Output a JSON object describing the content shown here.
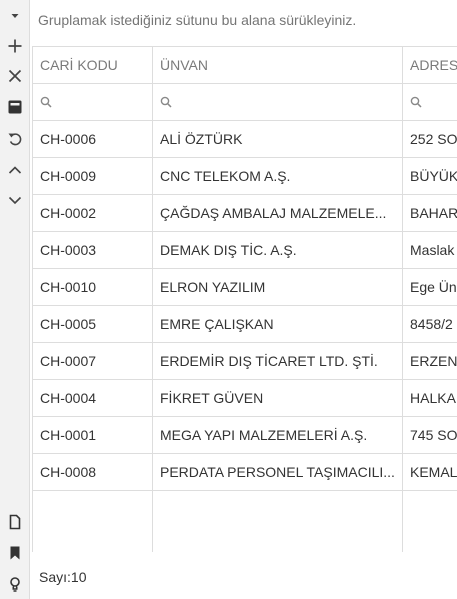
{
  "group_panel": {
    "text": "Gruplamak istediğiniz sütunu bu alana sürükleyiniz."
  },
  "columns": [
    "CARİ KODU",
    "ÜNVAN",
    "ADRES"
  ],
  "rows": [
    {
      "code": "CH-0006",
      "title": "ALİ ÖZTÜRK",
      "address": "252 SO"
    },
    {
      "code": "CH-0009",
      "title": "CNC TELEKOM A.Ş.",
      "address": "BÜYÜK"
    },
    {
      "code": "CH-0002",
      "title": "ÇAĞDAŞ AMBALAJ MALZEMELE...",
      "address": "BAHAR"
    },
    {
      "code": "CH-0003",
      "title": "DEMAK DIŞ TİC. A.Ş.",
      "address": "Maslak"
    },
    {
      "code": "CH-0010",
      "title": "ELRON YAZILIM",
      "address": "Ege Ün"
    },
    {
      "code": "CH-0005",
      "title": "EMRE ÇALIŞKAN",
      "address": "8458/2"
    },
    {
      "code": "CH-0007",
      "title": "ERDEMİR DIŞ TİCARET LTD. ŞTİ.",
      "address": "ERZENİ"
    },
    {
      "code": "CH-0004",
      "title": "FİKRET GÜVEN",
      "address": "HALKA"
    },
    {
      "code": "CH-0001",
      "title": "MEGA YAPI MALZEMELERİ A.Ş.",
      "address": "745 SO"
    },
    {
      "code": "CH-0008",
      "title": "PERDATA PERSONEL TAŞIMACILI...",
      "address": "KEMAL"
    }
  ],
  "footer": {
    "count": "Sayı:10"
  },
  "icons": {
    "toolbar_top": [
      "dropdown-arrow-icon",
      "add-icon",
      "delete-icon",
      "save-icon",
      "undo-icon",
      "collapse-up-icon",
      "expand-down-icon"
    ],
    "toolbar_bottom": [
      "new-document-icon",
      "bookmark-icon",
      "hint-bulb-icon"
    ],
    "filter": "search-icon"
  },
  "colors": {
    "toolbar_bg": "#f2f2f2",
    "grid_border": "#dddddd",
    "header_text": "#7a7a7a",
    "text": "#333333"
  }
}
